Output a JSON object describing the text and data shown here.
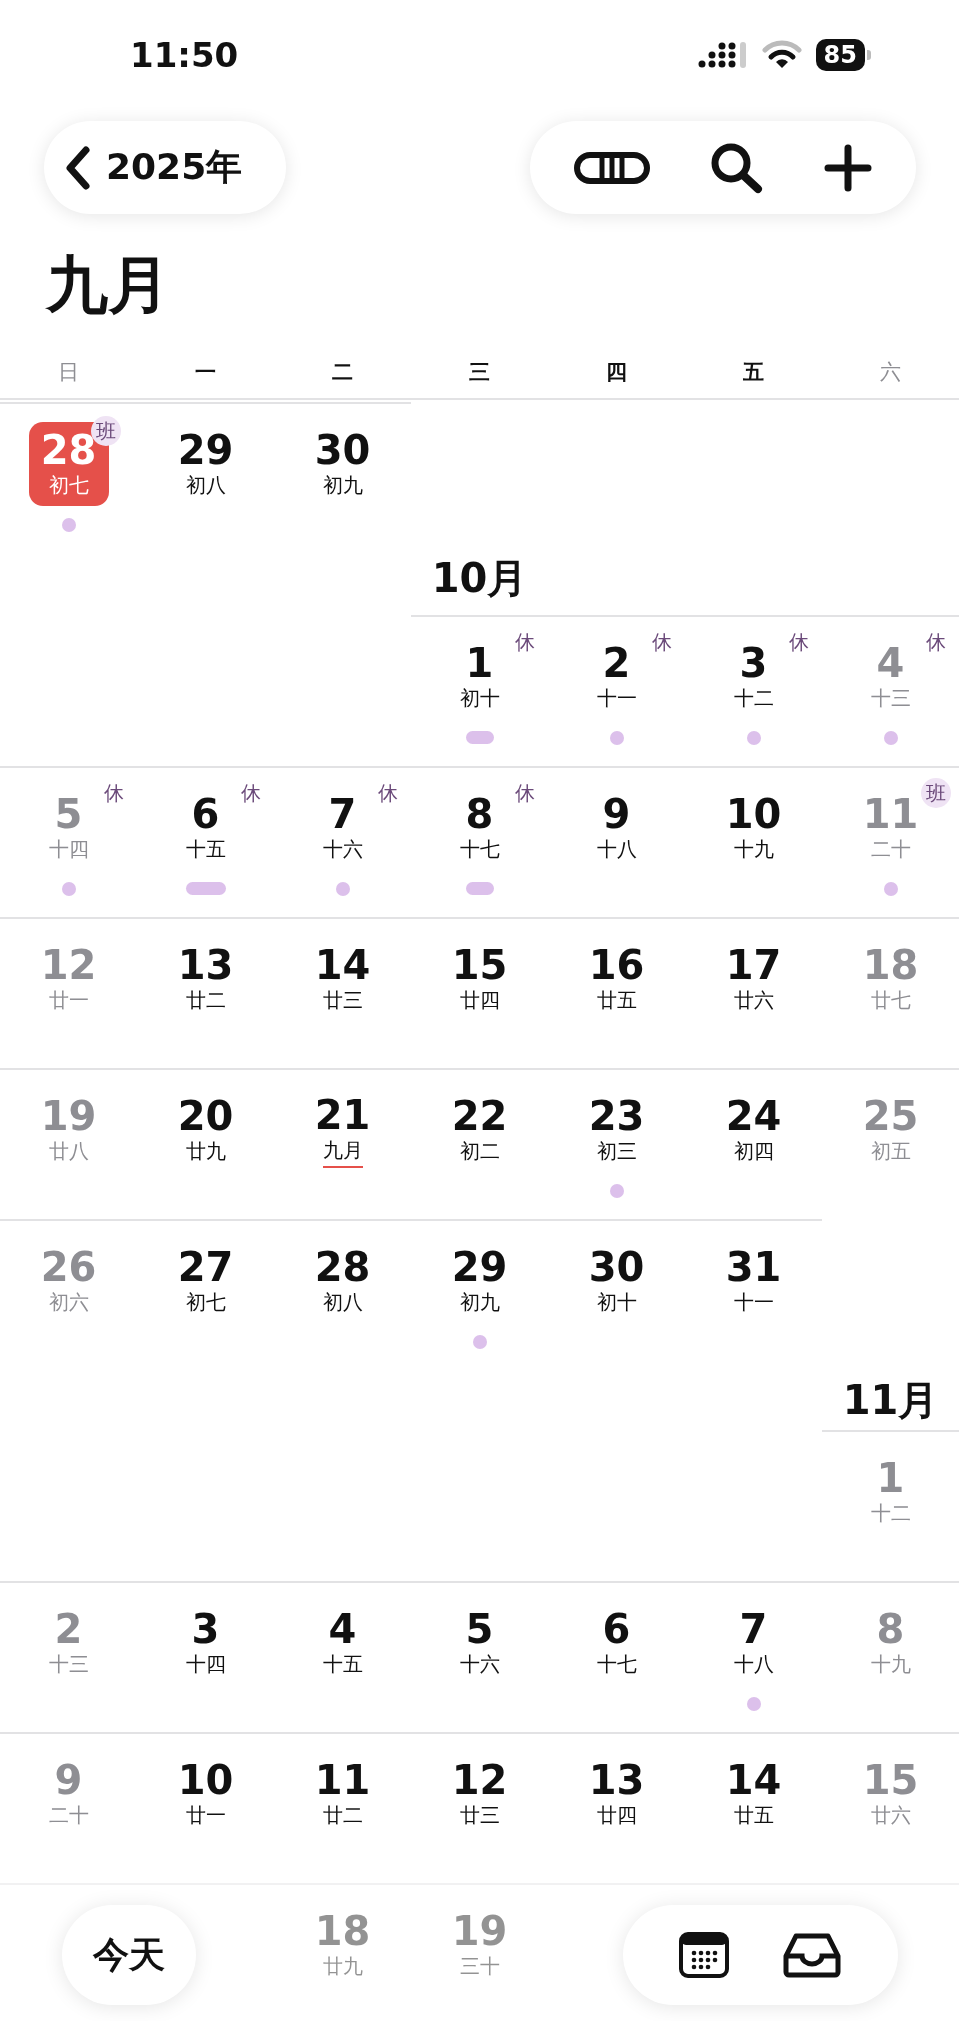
{
  "status_bar": {
    "time": "11:50",
    "battery": "85"
  },
  "nav": {
    "back_label": "2025年"
  },
  "title": "九月",
  "weekdays": [
    {
      "label": "日",
      "weekend": true
    },
    {
      "label": "一",
      "weekend": false
    },
    {
      "label": "二",
      "weekend": false
    },
    {
      "label": "三",
      "weekend": false
    },
    {
      "label": "四",
      "weekend": false
    },
    {
      "label": "五",
      "weekend": false
    },
    {
      "label": "六",
      "weekend": true
    }
  ],
  "months": [
    {
      "weeks": [
        {
          "days": [
            {
              "kind": "day",
              "number": "28",
              "lunar": "初七",
              "weekend": true,
              "today": true,
              "badge": {
                "text": "班",
                "kind": "work"
              },
              "event": {
                "kind": "dot"
              }
            },
            {
              "kind": "day",
              "number": "29",
              "lunar": "初八",
              "weekend": false,
              "today": false
            },
            {
              "kind": "day",
              "number": "30",
              "lunar": "初九",
              "weekend": false,
              "today": false
            },
            {
              "kind": "empty"
            },
            {
              "kind": "empty"
            },
            {
              "kind": "empty"
            },
            {
              "kind": "empty"
            }
          ]
        }
      ]
    },
    {
      "title": "10月",
      "weeks": [
        {
          "days": [
            {
              "kind": "empty"
            },
            {
              "kind": "empty"
            },
            {
              "kind": "empty"
            },
            {
              "kind": "day",
              "number": "1",
              "lunar": "初十",
              "weekend": false,
              "today": false,
              "badge": {
                "text": "休",
                "kind": "rest"
              },
              "event": {
                "kind": "bar"
              }
            },
            {
              "kind": "day",
              "number": "2",
              "lunar": "十一",
              "weekend": false,
              "today": false,
              "badge": {
                "text": "休",
                "kind": "rest"
              },
              "event": {
                "kind": "dot"
              }
            },
            {
              "kind": "day",
              "number": "3",
              "lunar": "十二",
              "weekend": false,
              "today": false,
              "badge": {
                "text": "休",
                "kind": "rest"
              },
              "event": {
                "kind": "dot"
              }
            },
            {
              "kind": "day",
              "number": "4",
              "lunar": "十三",
              "weekend": true,
              "today": false,
              "badge": {
                "text": "休",
                "kind": "rest"
              },
              "event": {
                "kind": "dot"
              }
            }
          ]
        },
        {
          "days": [
            {
              "kind": "day",
              "number": "5",
              "lunar": "十四",
              "weekend": true,
              "today": false,
              "badge": {
                "text": "休",
                "kind": "rest"
              },
              "event": {
                "kind": "dot"
              }
            },
            {
              "kind": "day",
              "number": "6",
              "lunar": "十五",
              "weekend": false,
              "today": false,
              "badge": {
                "text": "休",
                "kind": "rest"
              },
              "event": {
                "kind": "bar"
              }
            },
            {
              "kind": "day",
              "number": "7",
              "lunar": "十六",
              "weekend": false,
              "today": false,
              "badge": {
                "text": "休",
                "kind": "rest"
              },
              "event": {
                "kind": "dot"
              }
            },
            {
              "kind": "day",
              "number": "8",
              "lunar": "十七",
              "weekend": false,
              "today": false,
              "badge": {
                "text": "休",
                "kind": "rest"
              },
              "event": {
                "kind": "bar"
              }
            },
            {
              "kind": "day",
              "number": "9",
              "lunar": "十八",
              "weekend": false,
              "today": false
            },
            {
              "kind": "day",
              "number": "10",
              "lunar": "十九",
              "weekend": false,
              "today": false
            },
            {
              "kind": "day",
              "number": "11",
              "lunar": "二十",
              "weekend": true,
              "today": false,
              "badge": {
                "text": "班",
                "kind": "work"
              },
              "event": {
                "kind": "dot"
              }
            }
          ]
        },
        {
          "days": [
            {
              "kind": "day",
              "number": "12",
              "lunar": "廿一",
              "weekend": true,
              "today": false
            },
            {
              "kind": "day",
              "number": "13",
              "lunar": "廿二",
              "weekend": false,
              "today": false
            },
            {
              "kind": "day",
              "number": "14",
              "lunar": "廿三",
              "weekend": false,
              "today": false
            },
            {
              "kind": "day",
              "number": "15",
              "lunar": "廿四",
              "weekend": false,
              "today": false
            },
            {
              "kind": "day",
              "number": "16",
              "lunar": "廿五",
              "weekend": false,
              "today": false
            },
            {
              "kind": "day",
              "number": "17",
              "lunar": "廿六",
              "weekend": false,
              "today": false
            },
            {
              "kind": "day",
              "number": "18",
              "lunar": "廿七",
              "weekend": true,
              "today": false
            }
          ]
        },
        {
          "days": [
            {
              "kind": "day",
              "number": "19",
              "lunar": "廿八",
              "weekend": true,
              "today": false
            },
            {
              "kind": "day",
              "number": "20",
              "lunar": "廿九",
              "weekend": false,
              "today": false
            },
            {
              "kind": "day",
              "number": "21",
              "lunar": "九月",
              "weekend": false,
              "today": false,
              "lunar_month_start": true
            },
            {
              "kind": "day",
              "number": "22",
              "lunar": "初二",
              "weekend": false,
              "today": false
            },
            {
              "kind": "day",
              "number": "23",
              "lunar": "初三",
              "weekend": false,
              "today": false,
              "event": {
                "kind": "dot"
              }
            },
            {
              "kind": "day",
              "number": "24",
              "lunar": "初四",
              "weekend": false,
              "today": false
            },
            {
              "kind": "day",
              "number": "25",
              "lunar": "初五",
              "weekend": true,
              "today": false
            }
          ]
        },
        {
          "days": [
            {
              "kind": "day",
              "number": "26",
              "lunar": "初六",
              "weekend": true,
              "today": false
            },
            {
              "kind": "day",
              "number": "27",
              "lunar": "初七",
              "weekend": false,
              "today": false
            },
            {
              "kind": "day",
              "number": "28",
              "lunar": "初八",
              "weekend": false,
              "today": false
            },
            {
              "kind": "day",
              "number": "29",
              "lunar": "初九",
              "weekend": false,
              "today": false,
              "event": {
                "kind": "dot"
              }
            },
            {
              "kind": "day",
              "number": "30",
              "lunar": "初十",
              "weekend": false,
              "today": false
            },
            {
              "kind": "day",
              "number": "31",
              "lunar": "十一",
              "weekend": false,
              "today": false
            },
            {
              "kind": "empty"
            }
          ]
        }
      ]
    },
    {
      "title": "11月",
      "weeks": [
        {
          "days": [
            {
              "kind": "empty"
            },
            {
              "kind": "empty"
            },
            {
              "kind": "empty"
            },
            {
              "kind": "empty"
            },
            {
              "kind": "empty"
            },
            {
              "kind": "empty"
            },
            {
              "kind": "day",
              "number": "1",
              "lunar": "十二",
              "weekend": true,
              "today": false
            }
          ]
        },
        {
          "days": [
            {
              "kind": "day",
              "number": "2",
              "lunar": "十三",
              "weekend": true,
              "today": false
            },
            {
              "kind": "day",
              "number": "3",
              "lunar": "十四",
              "weekend": false,
              "today": false
            },
            {
              "kind": "day",
              "number": "4",
              "lunar": "十五",
              "weekend": false,
              "today": false
            },
            {
              "kind": "day",
              "number": "5",
              "lunar": "十六",
              "weekend": false,
              "today": false
            },
            {
              "kind": "day",
              "number": "6",
              "lunar": "十七",
              "weekend": false,
              "today": false
            },
            {
              "kind": "day",
              "number": "7",
              "lunar": "十八",
              "weekend": false,
              "today": false,
              "event": {
                "kind": "dot"
              }
            },
            {
              "kind": "day",
              "number": "8",
              "lunar": "十九",
              "weekend": true,
              "today": false
            }
          ]
        },
        {
          "days": [
            {
              "kind": "day",
              "number": "9",
              "lunar": "二十",
              "weekend": true,
              "today": false
            },
            {
              "kind": "day",
              "number": "10",
              "lunar": "廿一",
              "weekend": false,
              "today": false
            },
            {
              "kind": "day",
              "number": "11",
              "lunar": "廿二",
              "weekend": false,
              "today": false
            },
            {
              "kind": "day",
              "number": "12",
              "lunar": "廿三",
              "weekend": false,
              "today": false
            },
            {
              "kind": "day",
              "number": "13",
              "lunar": "廿四",
              "weekend": false,
              "today": false
            },
            {
              "kind": "day",
              "number": "14",
              "lunar": "廿五",
              "weekend": false,
              "today": false
            },
            {
              "kind": "day",
              "number": "15",
              "lunar": "廿六",
              "weekend": true,
              "today": false
            }
          ]
        },
        {
          "dimmed": true,
          "days": [
            {
              "kind": "covered"
            },
            {
              "kind": "covered"
            },
            {
              "kind": "day",
              "number": "18",
              "lunar": "廿九",
              "today": false
            },
            {
              "kind": "day",
              "number": "19",
              "lunar": "三十",
              "today": false
            },
            {
              "kind": "covered"
            },
            {
              "kind": "covered"
            },
            {
              "kind": "covered"
            }
          ]
        }
      ]
    }
  ],
  "bottom_bar": {
    "today_label": "今天"
  }
}
